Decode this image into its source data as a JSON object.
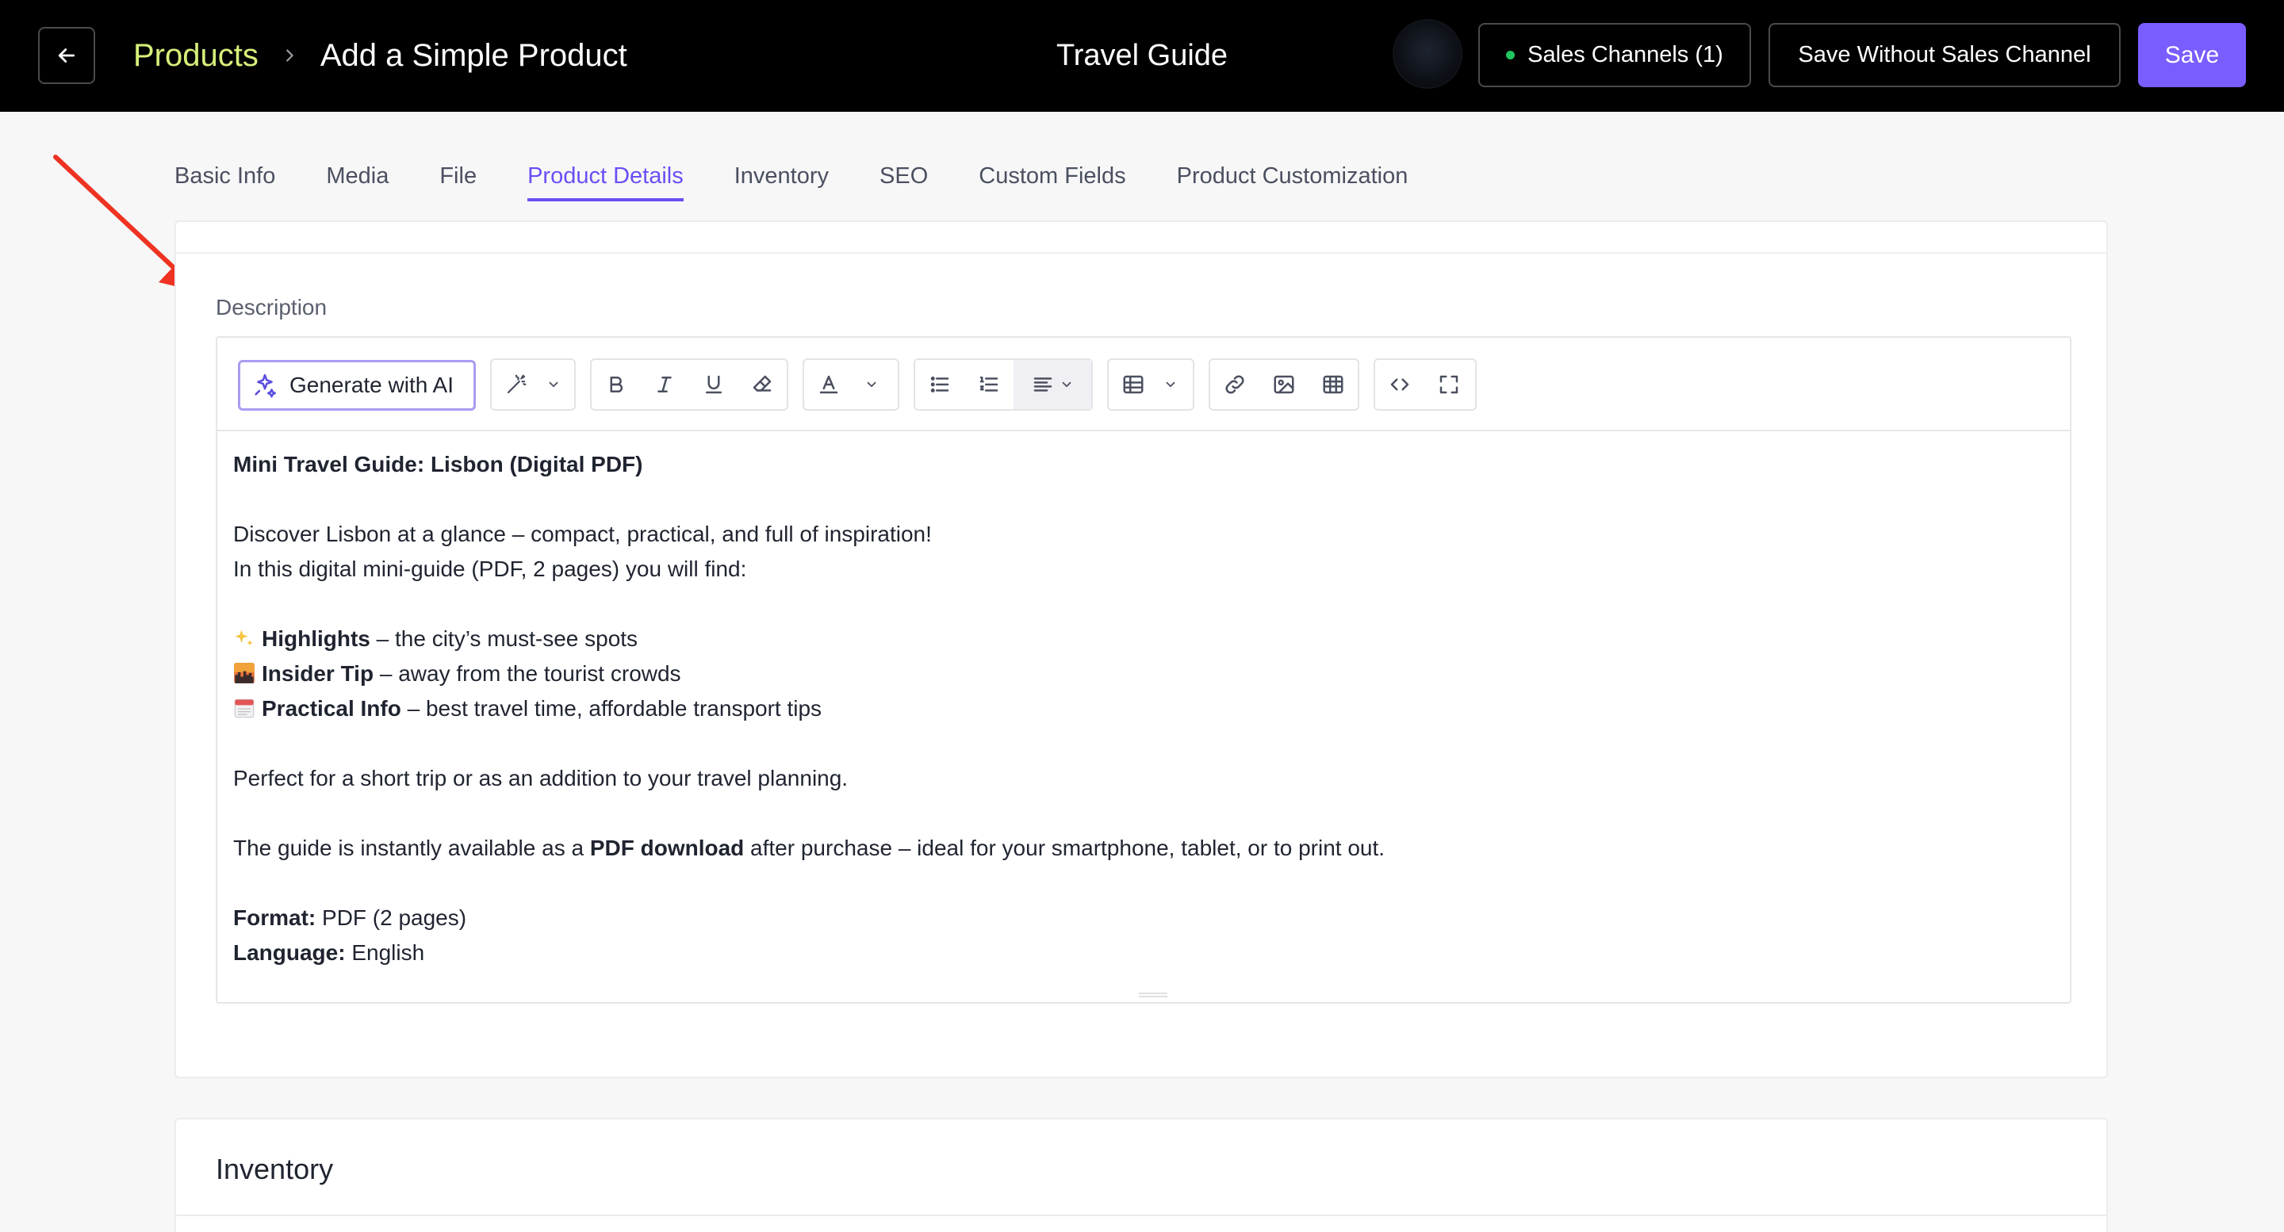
{
  "header": {
    "breadcrumb_root": "Products",
    "breadcrumb_current": "Add a Simple Product",
    "window_title": "Travel Guide",
    "sales_channels_label": "Sales Channels (1)",
    "save_without_label": "Save Without Sales Channel",
    "save_label": "Save",
    "accent_color": "#7b5cff",
    "breadcrumb_color": "#d7f07a",
    "status_dot_color": "#22c55e"
  },
  "tabs": [
    {
      "label": "Basic Info",
      "active": false
    },
    {
      "label": "Media",
      "active": false
    },
    {
      "label": "File",
      "active": false
    },
    {
      "label": "Product Details",
      "active": true
    },
    {
      "label": "Inventory",
      "active": false
    },
    {
      "label": "SEO",
      "active": false
    },
    {
      "label": "Custom Fields",
      "active": false
    },
    {
      "label": "Product Customization",
      "active": false
    }
  ],
  "description": {
    "label": "Description",
    "generate_ai_label": "Generate with AI",
    "toolbar_icons": [
      "ai-wand-icon",
      "bold-icon",
      "italic-icon",
      "underline-icon",
      "eraser-icon",
      "text-color-icon",
      "bullet-list-icon",
      "numbered-list-icon",
      "align-icon",
      "table-icon",
      "link-icon",
      "image-icon",
      "grid-icon",
      "code-icon",
      "fullscreen-icon"
    ],
    "content": {
      "heading": "Mini Travel Guide: Lisbon (Digital PDF)",
      "intro_1": "Discover Lisbon at a glance – compact, practical, and full of inspiration!",
      "intro_2": "In this digital mini-guide (PDF, 2 pages) you will find:",
      "items": [
        {
          "icon": "sparkles-icon",
          "bold": "Highlights",
          "text": " – the city’s must-see spots"
        },
        {
          "icon": "sunset-city-icon",
          "bold": "Insider Tip",
          "text": " – away from the tourist crowds"
        },
        {
          "icon": "calendar-icon",
          "bold": "Practical Info",
          "text": " – best travel time, affordable transport tips"
        }
      ],
      "perfect": "Perfect for a short trip or as an addition to your travel planning.",
      "download_pre": "The guide is instantly available as a ",
      "download_bold": "PDF download",
      "download_post": " after purchase – ideal for your smartphone, tablet, or to print out.",
      "format_label": "Format:",
      "format_value": " PDF (2 pages)",
      "language_label": "Language:",
      "language_value": " English"
    }
  },
  "inventory": {
    "title": "Inventory"
  }
}
